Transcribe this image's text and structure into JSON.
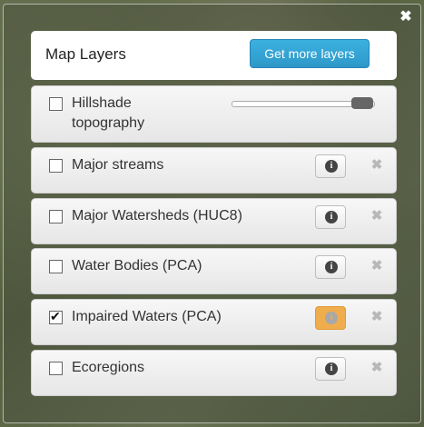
{
  "header": {
    "title": "Map Layers",
    "more_button": "Get more layers"
  },
  "close_icon": "close-icon",
  "layers": [
    {
      "label": "Hillshade topography",
      "checked": false,
      "control": "opacity-slider",
      "opacity": 1.0
    },
    {
      "label": "Major streams",
      "checked": false,
      "info_active": false
    },
    {
      "label": "Major Watersheds (HUC8)",
      "checked": false,
      "info_active": false
    },
    {
      "label": "Water Bodies (PCA)",
      "checked": false,
      "info_active": false
    },
    {
      "label": "Impaired Waters (PCA)",
      "checked": true,
      "info_active": true
    },
    {
      "label": "Ecoregions",
      "checked": false,
      "info_active": false
    }
  ],
  "colors": {
    "accent": "#2d98c8",
    "info_active": "#f0ad4e"
  }
}
